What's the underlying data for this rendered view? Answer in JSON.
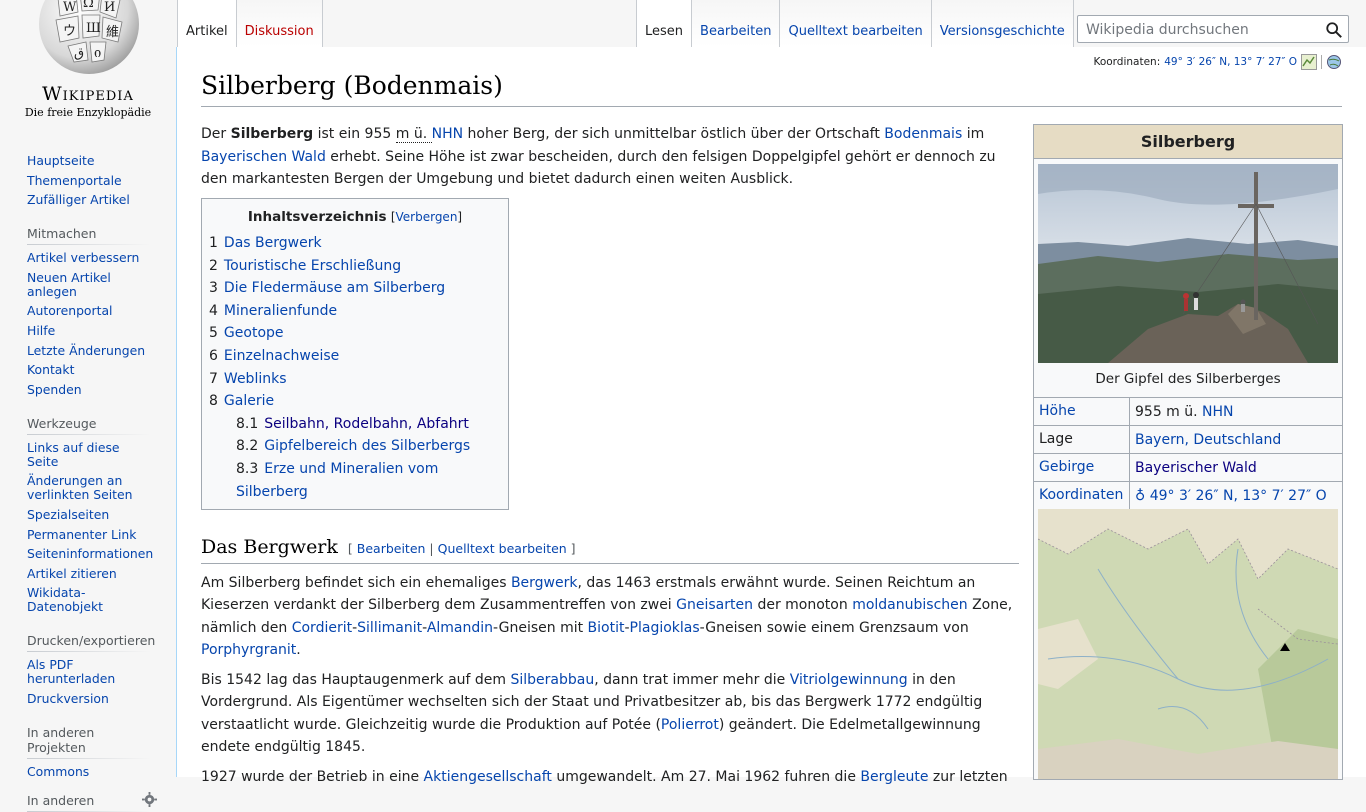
{
  "logo": {
    "wordmark": "Wikipedia",
    "tagline": "Die freie Enzyklopädie",
    "icon": "wikipedia-globe"
  },
  "sidebar": {
    "navigation": [
      "Hauptseite",
      "Themenportale",
      "Zufälliger Artikel"
    ],
    "mitmachen": {
      "heading": "Mitmachen",
      "items": [
        "Artikel verbessern",
        "Neuen Artikel anlegen",
        "Autorenportal",
        "Hilfe",
        "Letzte Änderungen",
        "Kontakt",
        "Spenden"
      ]
    },
    "werkzeuge": {
      "heading": "Werkzeuge",
      "items": [
        "Links auf diese Seite",
        "Änderungen an verlinkten Seiten",
        "Spezialseiten",
        "Permanenter Link",
        "Seiteninformationen",
        "Artikel zitieren",
        "Wikidata-Datenobjekt"
      ]
    },
    "drucken": {
      "heading": "Drucken/exportieren",
      "items": [
        "Als PDF herunterladen",
        "Druckversion"
      ]
    },
    "projekte": {
      "heading": "In anderen Projekten",
      "items": [
        "Commons"
      ]
    },
    "sprachen": {
      "heading": "In anderen"
    }
  },
  "tabs": {
    "left": [
      "Artikel",
      "Diskussion"
    ],
    "right": [
      "Lesen",
      "Bearbeiten",
      "Quelltext bearbeiten",
      "Versionsgeschichte"
    ]
  },
  "search": {
    "placeholder": "Wikipedia durchsuchen"
  },
  "coordinates": {
    "label": "Koordinaten:",
    "value": "49° 3′ 26″ N, 13° 7′ 27″ O"
  },
  "article": {
    "title": "Silberberg (Bodenmais)",
    "intro": {
      "t1": "Der ",
      "name": "Silberberg",
      "t2": " ist ein 955 ",
      "unit": "m ü. ",
      "nhn": "NHN",
      "t3": " hoher Berg, der sich unmittelbar östlich über der Ortschaft ",
      "l1": "Bodenmais",
      "t4": " im ",
      "l2": "Bayerischen Wald",
      "t5": " erhebt. Seine Höhe ist zwar bescheiden, durch den felsigen Doppelgipfel gehört er dennoch zu den markantesten Bergen der Umgebung und bietet dadurch einen weiten Ausblick."
    },
    "toc": {
      "title": "Inhaltsverzeichnis",
      "toggle": "Verbergen",
      "items": [
        {
          "num": "1",
          "label": "Das Bergwerk"
        },
        {
          "num": "2",
          "label": "Touristische Erschließung"
        },
        {
          "num": "3",
          "label": "Die Fledermäuse am Silberberg"
        },
        {
          "num": "4",
          "label": "Mineralienfunde"
        },
        {
          "num": "5",
          "label": "Geotope"
        },
        {
          "num": "6",
          "label": "Einzelnachweise"
        },
        {
          "num": "7",
          "label": "Weblinks"
        },
        {
          "num": "8",
          "label": "Galerie"
        }
      ],
      "sub": [
        {
          "num": "8.1",
          "label": "Seilbahn, Rodelbahn, Abfahrt"
        },
        {
          "num": "8.2",
          "label": "Gipfelbereich des Silberbergs"
        },
        {
          "num": "8.3",
          "label": "Erze und Mineralien vom Silberberg"
        }
      ]
    },
    "section1": {
      "heading": "Das Bergwerk",
      "edit": "Bearbeiten",
      "edit_source": "Quelltext bearbeiten",
      "p1": {
        "t1": "Am Silberberg befindet sich ein ehemaliges ",
        "l1": "Bergwerk",
        "t2": ", das 1463 erstmals erwähnt wurde. Seinen Reichtum an Kieserzen verdankt der Silberberg dem Zusammentreffen von zwei ",
        "l2": "Gneisarten",
        "t3": " der monoton ",
        "l3": "moldanubischen",
        "t4": " Zone, nämlich den ",
        "l4": "Cordierit",
        "l5": "Sillimanit",
        "l6": "Almandin",
        "t5": "-Gneisen mit ",
        "l7": "Biotit",
        "l8": "Plagioklas",
        "t6": "-Gneisen sowie einem Grenzsaum von ",
        "l9": "Porphyrgranit",
        "t7": "."
      },
      "p2": {
        "t1": "Bis 1542 lag das Hauptaugenmerk auf dem ",
        "l1": "Silberabbau",
        "t2": ", dann trat immer mehr die ",
        "l2": "Vitriolgewinnung",
        "t3": " in den Vordergrund. Als Eigentümer wechselten sich der Staat und Privatbesitzer ab, bis das Bergwerk 1772 endgültig verstaatlicht wurde. Gleichzeitig wurde die Produktion auf Potée (",
        "l3": "Polierrot",
        "t4": ") geändert. Die Edelmetallgewinnung endete endgültig 1845."
      },
      "p3": {
        "t1": "1927 wurde der Betrieb in eine ",
        "l1": "Aktiengesellschaft",
        "t2": " umgewandelt. Am 27. Mai 1962 fuhren die ",
        "l2": "Bergleute",
        "t3": " zur letzten"
      }
    }
  },
  "infobox": {
    "title": "Silberberg",
    "caption": "Der Gipfel des Silberberges",
    "rows": [
      {
        "key": "Höhe",
        "value": "955 m ü. ",
        "value_link": "NHN"
      },
      {
        "key": "Lage",
        "value_link": "Bayern, Deutschland"
      },
      {
        "key": "Gebirge",
        "value": "Bayerischer Wald"
      },
      {
        "key": "Koordinaten",
        "value_link": "♁ 49° 3′ 26″ N, 13° 7′ 27″ O"
      }
    ]
  }
}
